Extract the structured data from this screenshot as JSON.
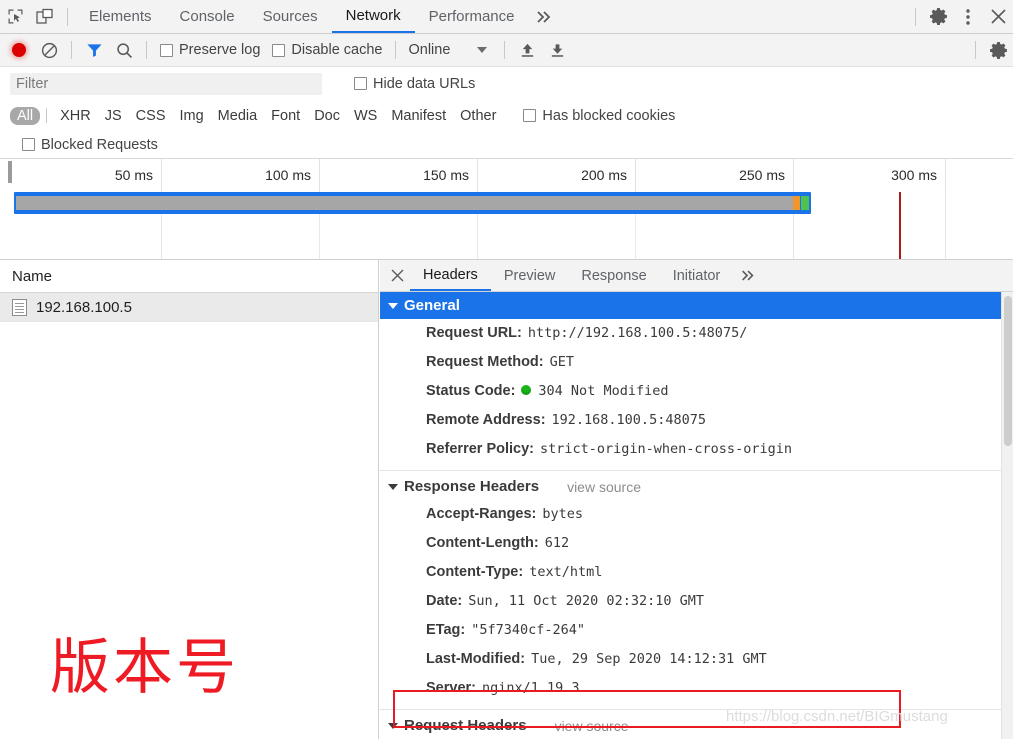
{
  "devtools_tabs": {
    "inspect_icon": "inspect-cursor-icon",
    "device_icon": "device-toolbar-icon",
    "items": [
      {
        "label": "Elements",
        "selected": false
      },
      {
        "label": "Console",
        "selected": false
      },
      {
        "label": "Sources",
        "selected": false
      },
      {
        "label": "Network",
        "selected": true
      },
      {
        "label": "Performance",
        "selected": false
      }
    ],
    "more_tabs_icon": "chevron-double-right-icon",
    "settings_icon": "gear-icon",
    "menu_icon": "kebab-menu-icon",
    "close_icon": "close-icon"
  },
  "network_toolbar": {
    "record_icon": "record-button-icon",
    "clear_icon": "clear-prohibited-icon",
    "filter_icon": "funnel-filter-icon",
    "search_icon": "search-icon",
    "preserve_log_label": "Preserve log",
    "preserve_log_checked": false,
    "disable_cache_label": "Disable cache",
    "disable_cache_checked": false,
    "throttle_value": "Online",
    "import_icon": "upload-arrow-icon",
    "export_icon": "download-arrow-icon",
    "settings_icon": "gear-icon"
  },
  "filter_bar": {
    "placeholder": "Filter",
    "value": "",
    "hide_data_urls_label": "Hide data URLs",
    "hide_data_urls_checked": false
  },
  "type_filters": {
    "items": [
      {
        "label": "All",
        "active": true
      },
      {
        "label": "XHR",
        "active": false
      },
      {
        "label": "JS",
        "active": false
      },
      {
        "label": "CSS",
        "active": false
      },
      {
        "label": "Img",
        "active": false
      },
      {
        "label": "Media",
        "active": false
      },
      {
        "label": "Font",
        "active": false
      },
      {
        "label": "Doc",
        "active": false
      },
      {
        "label": "WS",
        "active": false
      },
      {
        "label": "Manifest",
        "active": false
      },
      {
        "label": "Other",
        "active": false
      }
    ],
    "has_blocked_cookies_label": "Has blocked cookies",
    "has_blocked_cookies_checked": false,
    "blocked_requests_label": "Blocked Requests",
    "blocked_requests_checked": false
  },
  "overview": {
    "ticks": [
      "50 ms",
      "100 ms",
      "150 ms",
      "200 ms",
      "250 ms",
      "300 ms"
    ],
    "bar_color": "#1a73e8",
    "bar_body_color": "#a6a6a6",
    "segment_orange": "#f0962d",
    "segment_green": "#4fc24f",
    "redline_color": "#b01919"
  },
  "request_list": {
    "column_header": "Name",
    "rows": [
      {
        "name": "192.168.100.5",
        "icon": "document-icon",
        "selected": true
      }
    ]
  },
  "annotation": {
    "cjk_note": "版本号",
    "watermark": "https://blog.csdn.net/BIGmustang"
  },
  "details": {
    "close_label": "✕",
    "tabs": [
      {
        "label": "Headers",
        "selected": true
      },
      {
        "label": "Preview",
        "selected": false
      },
      {
        "label": "Response",
        "selected": false
      },
      {
        "label": "Initiator",
        "selected": false
      }
    ],
    "more_tabs_icon": "chevron-double-right-icon",
    "sections": [
      {
        "title": "General",
        "style": "blue",
        "view_source": "",
        "rows": [
          {
            "key": "Request URL:",
            "value": "http://192.168.100.5:48075/",
            "status": false
          },
          {
            "key": "Request Method:",
            "value": "GET",
            "status": false
          },
          {
            "key": "Status Code:",
            "value": "304 Not Modified",
            "status": true
          },
          {
            "key": "Remote Address:",
            "value": "192.168.100.5:48075",
            "status": false
          },
          {
            "key": "Referrer Policy:",
            "value": "strict-origin-when-cross-origin",
            "status": false
          }
        ]
      },
      {
        "title": "Response Headers",
        "style": "plain",
        "view_source": "view source",
        "rows": [
          {
            "key": "Accept-Ranges:",
            "value": "bytes",
            "status": false
          },
          {
            "key": "Content-Length:",
            "value": "612",
            "status": false
          },
          {
            "key": "Content-Type:",
            "value": "text/html",
            "status": false
          },
          {
            "key": "Date:",
            "value": "Sun, 11 Oct 2020 02:32:10 GMT",
            "status": false
          },
          {
            "key": "ETag:",
            "value": "\"5f7340cf-264\"",
            "status": false
          },
          {
            "key": "Last-Modified:",
            "value": "Tue, 29 Sep 2020 14:12:31 GMT",
            "status": false
          },
          {
            "key": "Server:",
            "value": "nginx/1.19.3",
            "status": false
          }
        ]
      },
      {
        "title": "Request Headers",
        "style": "plain",
        "view_source": "view source",
        "rows": []
      }
    ]
  }
}
